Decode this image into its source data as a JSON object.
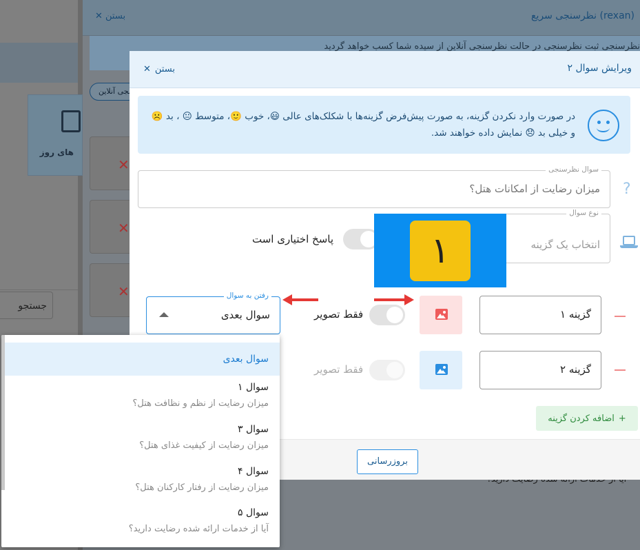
{
  "background": {
    "search_button": "جستجو",
    "panel_title": "نظرسنجی سریع (rexan)",
    "panel_close": "بستن",
    "subbar_text": "نظرسنجی ثبت نظرسنجی در حالت نظرسنجی آنلاین از سیده شما کسب خواهد گردید",
    "pill_label": "نظرسنجی آنلاین",
    "tile_label": "های روز",
    "bottom_text": "آیا از خدمات ارائه شده رضایت دارید؟"
  },
  "modal": {
    "title": "ویرایش سوال ۲",
    "close_label": "بستن",
    "info_text": "در صورت وارد نکردن گزینه، به صورت پیش‌فرض گزینه‌ها با شکلک‌های عالی 😃، خوب 🙂، متوسط 😐 ، بد ☹️ و خیلی بد 😞 نمایش داده خواهند شد.",
    "question_field": {
      "legend": "سوال نظرسنجی",
      "value": "میزان رضایت از امکانات هتل؟"
    },
    "type_field": {
      "legend": "نوع سوال",
      "value": "انتخاب یک گزینه"
    },
    "optional_label": "پاسخ اختیاری است",
    "badge_number": "۱",
    "goto_field": {
      "legend": "رفتن به سوال",
      "value": "سوال بعدی"
    },
    "options": [
      {
        "value": "گزینه ۱",
        "image_only_label": "فقط تصویر"
      },
      {
        "value": "گزینه ۲",
        "image_only_label": "فقط تصویر"
      }
    ],
    "add_option_label": "اضافه کردن گزینه",
    "update_button": "بروزرسانی"
  },
  "dropdown": {
    "selected": "سوال بعدی",
    "items": [
      {
        "title": "سوال ۱",
        "sub": "میزان رضایت از نظم و نظافت هتل؟"
      },
      {
        "title": "سوال ۳",
        "sub": "میزان رضایت از کیفیت غذای هتل؟"
      },
      {
        "title": "سوال ۴",
        "sub": "میزان رضایت از رفتار کارکنان هتل؟"
      },
      {
        "title": "سوال ۵",
        "sub": "آیا از خدمات ارائه شده رضایت دارید؟"
      }
    ]
  },
  "colors": {
    "accent": "#2a8ee0",
    "badge_bg": "#0a8ef0",
    "badge_inner": "#f4c210",
    "arrow": "#e53935",
    "add_option_bg": "#e3f5e6"
  },
  "icons": {
    "info": "smiley-icon",
    "help": "question-icon",
    "type": "laptop-icon",
    "image": "image-icon",
    "remove": "minus-icon",
    "add": "plus-icon",
    "close": "close-icon",
    "caret": "caret-up-icon"
  }
}
